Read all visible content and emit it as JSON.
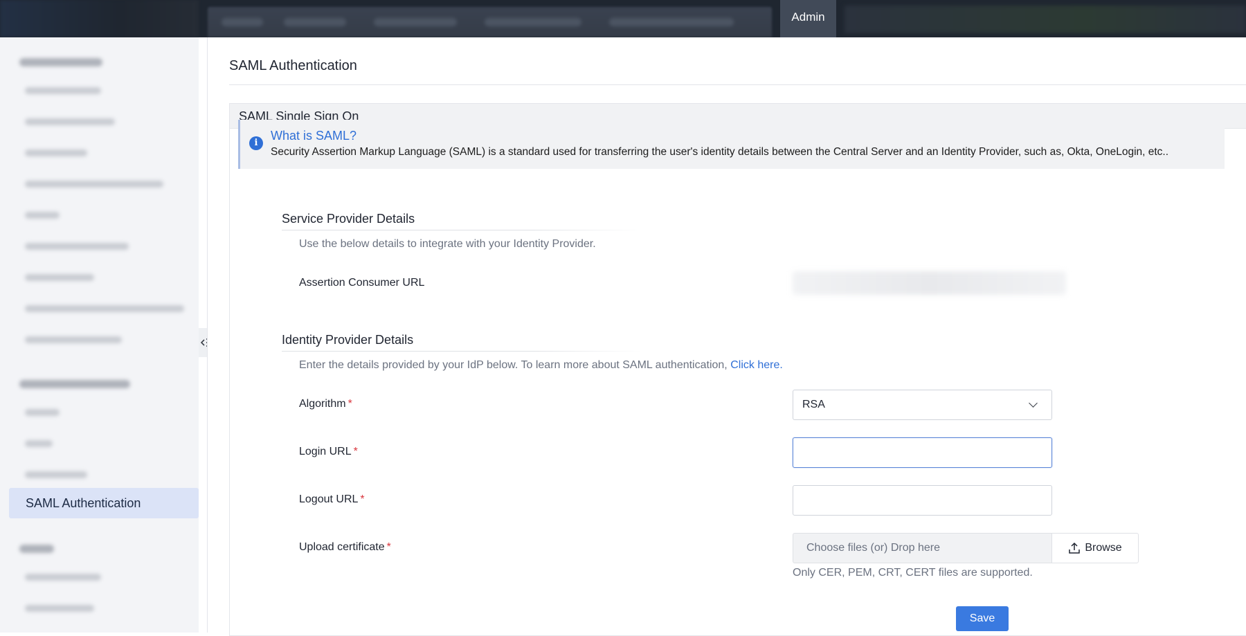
{
  "topbar": {
    "admin_tab": "Admin"
  },
  "sidebar": {
    "active_item": "SAML Authentication"
  },
  "page": {
    "title": "SAML Authentication"
  },
  "section": {
    "header": "SAML Single Sign On"
  },
  "info": {
    "title": "What is SAML?",
    "description": "Security Assertion Markup Language (SAML) is a standard used for transferring the user's identity details between the Central Server and an Identity Provider, such as, Okta, OneLogin, etc.."
  },
  "service_provider": {
    "heading": "Service Provider Details",
    "help": "Use the below details to integrate with your Identity Provider.",
    "acs_label": "Assertion Consumer URL"
  },
  "identity_provider": {
    "heading": "Identity Provider Details",
    "help": "Enter the details provided by your IdP below. To learn more about SAML authentication, ",
    "help_link": "Click here.",
    "algorithm_label": "Algorithm",
    "algorithm_value": "RSA",
    "login_url_label": "Login URL",
    "login_url_value": "",
    "logout_url_label": "Logout URL",
    "logout_url_value": "",
    "certificate_label": "Upload certificate",
    "file_drop_placeholder": "Choose files (or) Drop here",
    "browse_label": "Browse",
    "file_note": "Only CER, PEM, CRT, CERT files are supported.",
    "required_mark": "*"
  },
  "actions": {
    "save_label": "Save"
  },
  "icons": {
    "info": "info-icon",
    "chevron": "chevron-down-icon",
    "upload": "upload-icon",
    "collapse": "sidebar-collapse-icon"
  },
  "colors": {
    "accent": "#2f6fd6",
    "save_button": "#3a7ae0",
    "required": "#d9363e",
    "active_sidebar_bg": "#dbe3f7"
  }
}
